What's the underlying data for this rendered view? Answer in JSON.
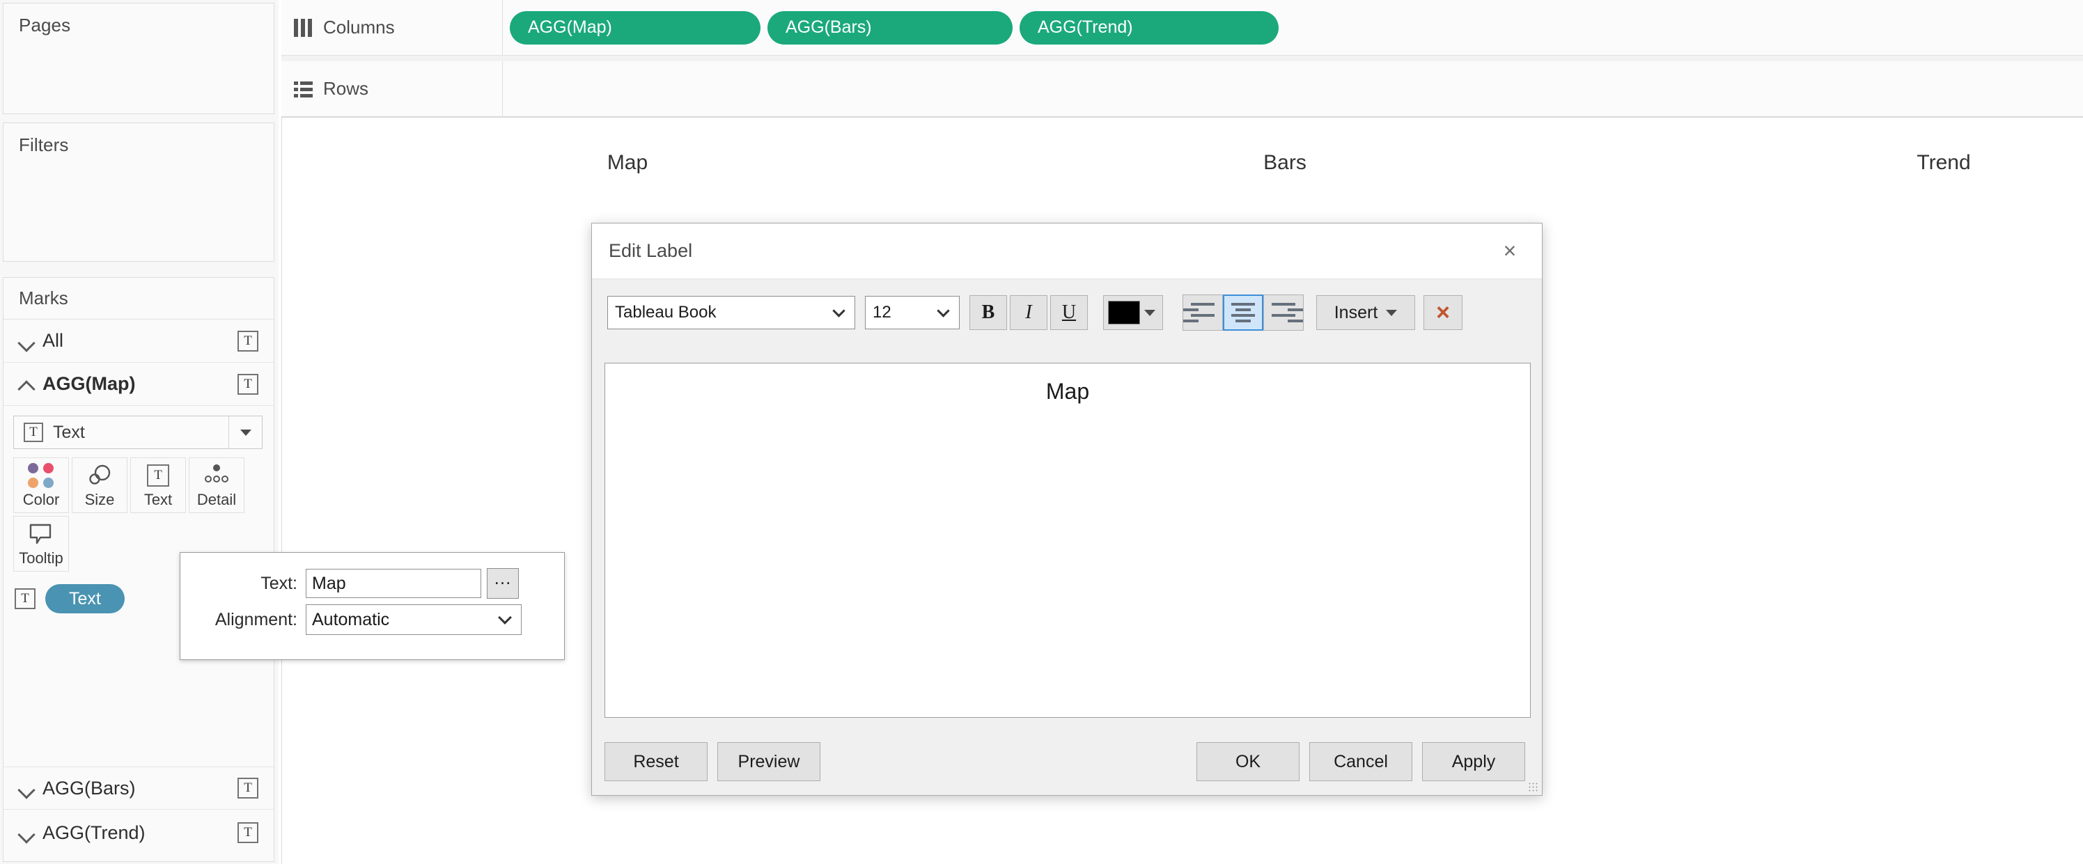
{
  "sidebar": {
    "pages": {
      "title": "Pages"
    },
    "filters": {
      "title": "Filters"
    },
    "marks": {
      "title": "Marks",
      "all_row": {
        "label": "All"
      },
      "agg_map": {
        "label": "AGG(Map)",
        "mark_type": "Text",
        "props": [
          {
            "name": "Color"
          },
          {
            "name": "Size"
          },
          {
            "name": "Text"
          },
          {
            "name": "Detail"
          },
          {
            "name": "Tooltip"
          }
        ],
        "text_pill": "Text",
        "text_pill_color": "#4a93b2",
        "color_dots": [
          "#7b6a99",
          "#e8506c",
          "#eda36a",
          "#7fa7c7"
        ]
      },
      "agg_bars": {
        "label": "AGG(Bars)"
      },
      "agg_trend": {
        "label": "AGG(Trend)"
      }
    }
  },
  "shelves": {
    "columns": {
      "label": "Columns",
      "icon": "columns-icon",
      "pills": [
        {
          "label": "AGG(Map)"
        },
        {
          "label": "AGG(Bars)"
        },
        {
          "label": "AGG(Trend)"
        }
      ],
      "pill_color": "#1ba97c"
    },
    "rows": {
      "label": "Rows",
      "icon": "rows-icon",
      "pills": []
    }
  },
  "viz": {
    "column_headers": [
      "Map",
      "Bars",
      "Trend"
    ]
  },
  "text_popup": {
    "text_label": "Text:",
    "text_value": "Map",
    "ellipsis_label": "...",
    "alignment_label": "Alignment:",
    "alignment_value": "Automatic"
  },
  "dialog": {
    "title": "Edit Label",
    "close_icon": "×",
    "toolbar": {
      "font_family": "Tableau Book",
      "font_size": "12",
      "bold": "B",
      "italic": "I",
      "underline": "U",
      "color_swatch": "#000000",
      "align_left": "align-left",
      "align_center": "align-center",
      "align_right": "align-right",
      "selected_alignment": "align-center",
      "insert_label": "Insert",
      "clear_label": "×"
    },
    "editor": {
      "content": "Map"
    },
    "buttons": {
      "reset": "Reset",
      "preview": "Preview",
      "ok": "OK",
      "cancel": "Cancel",
      "apply": "Apply"
    }
  }
}
